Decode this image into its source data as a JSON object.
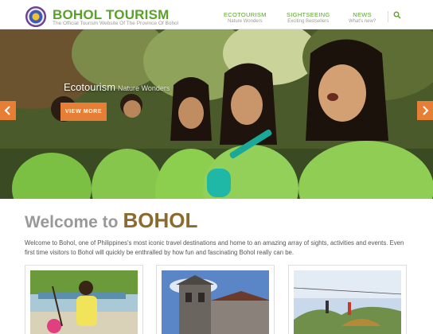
{
  "header": {
    "brand_title": "BOHOL TOURISM",
    "brand_subtitle": "The Official Tourism Website Of The Province Of Bohol",
    "nav": [
      {
        "title": "ECOTOURISM",
        "subtitle": "Nature Wonders"
      },
      {
        "title": "SIGHTSEEING",
        "subtitle": "Exciting Bestsellers"
      },
      {
        "title": "NEWS",
        "subtitle": "What's new?"
      }
    ],
    "search_icon": "search-icon"
  },
  "hero": {
    "title": "Ecotourism",
    "subtitle": "Nature Wonders",
    "button_label": "VIEW MORE",
    "prev_icon": "chevron-left-icon",
    "next_icon": "chevron-right-icon"
  },
  "welcome": {
    "title_part1": "Welcome to",
    "title_part2": "BOHOL",
    "intro": "Welcome to Bohol, one of Philippines's most iconic travel destinations and home to an amazing array of sights, activities and events. Even first time visitors to Bohol will quickly be enthralled by how fun and fascinating Bohol really can be."
  },
  "colors": {
    "brand_green": "#5aa12a",
    "accent_orange": "#e67e35",
    "welcome_gold": "#8a6a2d"
  }
}
